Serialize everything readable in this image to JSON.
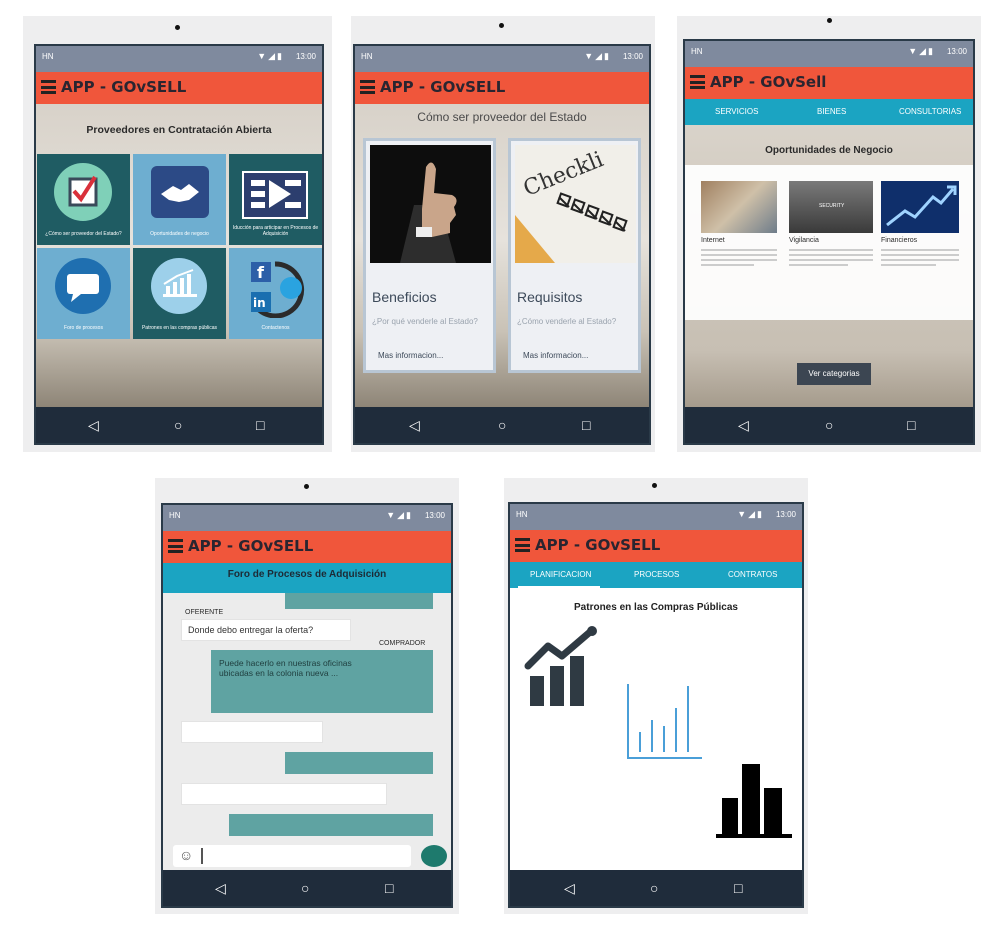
{
  "common": {
    "carrier": "HN",
    "time": "13:00",
    "app_title_upper": "APP - GOvSELL",
    "app_title_mixed": "APP - GOvSell",
    "status_icons": "▼◢▮"
  },
  "screen1": {
    "heading": "Proveedores en Contratación Abierta",
    "tiles": [
      {
        "label": "¿Cómo ser proveedor del Estado?",
        "icon": "checkbox-icon",
        "bg": "#1f5c63"
      },
      {
        "label": "Oportunidades de negocio",
        "icon": "handshake-icon",
        "bg": "#6eaed0"
      },
      {
        "label": "Iducción para articipar en Procesos de Adquisición",
        "icon": "video-list-icon",
        "bg": "#1f5c63"
      },
      {
        "label": "Foro de procesos",
        "icon": "chat-bubble-icon",
        "bg": "#6eaed0"
      },
      {
        "label": "Patrones en las compras públicas",
        "icon": "bar-chart-icon",
        "bg": "#1f5c63"
      },
      {
        "label": "Contactenos",
        "icon": "social-icon",
        "bg": "#6eaed0"
      }
    ]
  },
  "screen2": {
    "heading": "Cómo ser proveedor del Estado",
    "cards": [
      {
        "title": "Beneficios",
        "subtitle": "¿Por qué venderle al Estado?",
        "more": "Mas informacion..."
      },
      {
        "title": "Requisitos",
        "subtitle": "¿Cómo venderle al Estado?",
        "more": "Mas informacion..."
      }
    ],
    "checklist_word": "Checkli"
  },
  "screen3": {
    "tabs": [
      "SERVICIOS",
      "BIENES",
      "CONSULTORIAS"
    ],
    "heading": "Oportunidades de Negocio",
    "items": [
      {
        "title": "Internet"
      },
      {
        "title": "Vigilancia"
      },
      {
        "title": "Financieros"
      }
    ],
    "security_badge": "SECURITY",
    "button": "Ver categorias"
  },
  "screen4": {
    "heading": "Foro de Procesos de Adquisición",
    "oferente_label": "OFERENTE",
    "oferente_msg": "Donde debo entregar la oferta?",
    "comprador_label": "COMPRADOR",
    "comprador_msg": "Puede hacerlo en nuestras oficinas ubicadas en la colonia nueva ..."
  },
  "screen5": {
    "tabs": [
      "PLANIFICACION",
      "PROCESOS",
      "CONTRATOS"
    ],
    "heading": "Patrones en las Compras Públicas"
  },
  "colors": {
    "appbar": "#f0563b",
    "status": "#7f8a9e",
    "navbar": "#1f2c3b",
    "tabs": "#1ba4c2",
    "bubble_out": "#5fa3a2",
    "tile_dark": "#1f5c63",
    "tile_light": "#6eaed0"
  }
}
